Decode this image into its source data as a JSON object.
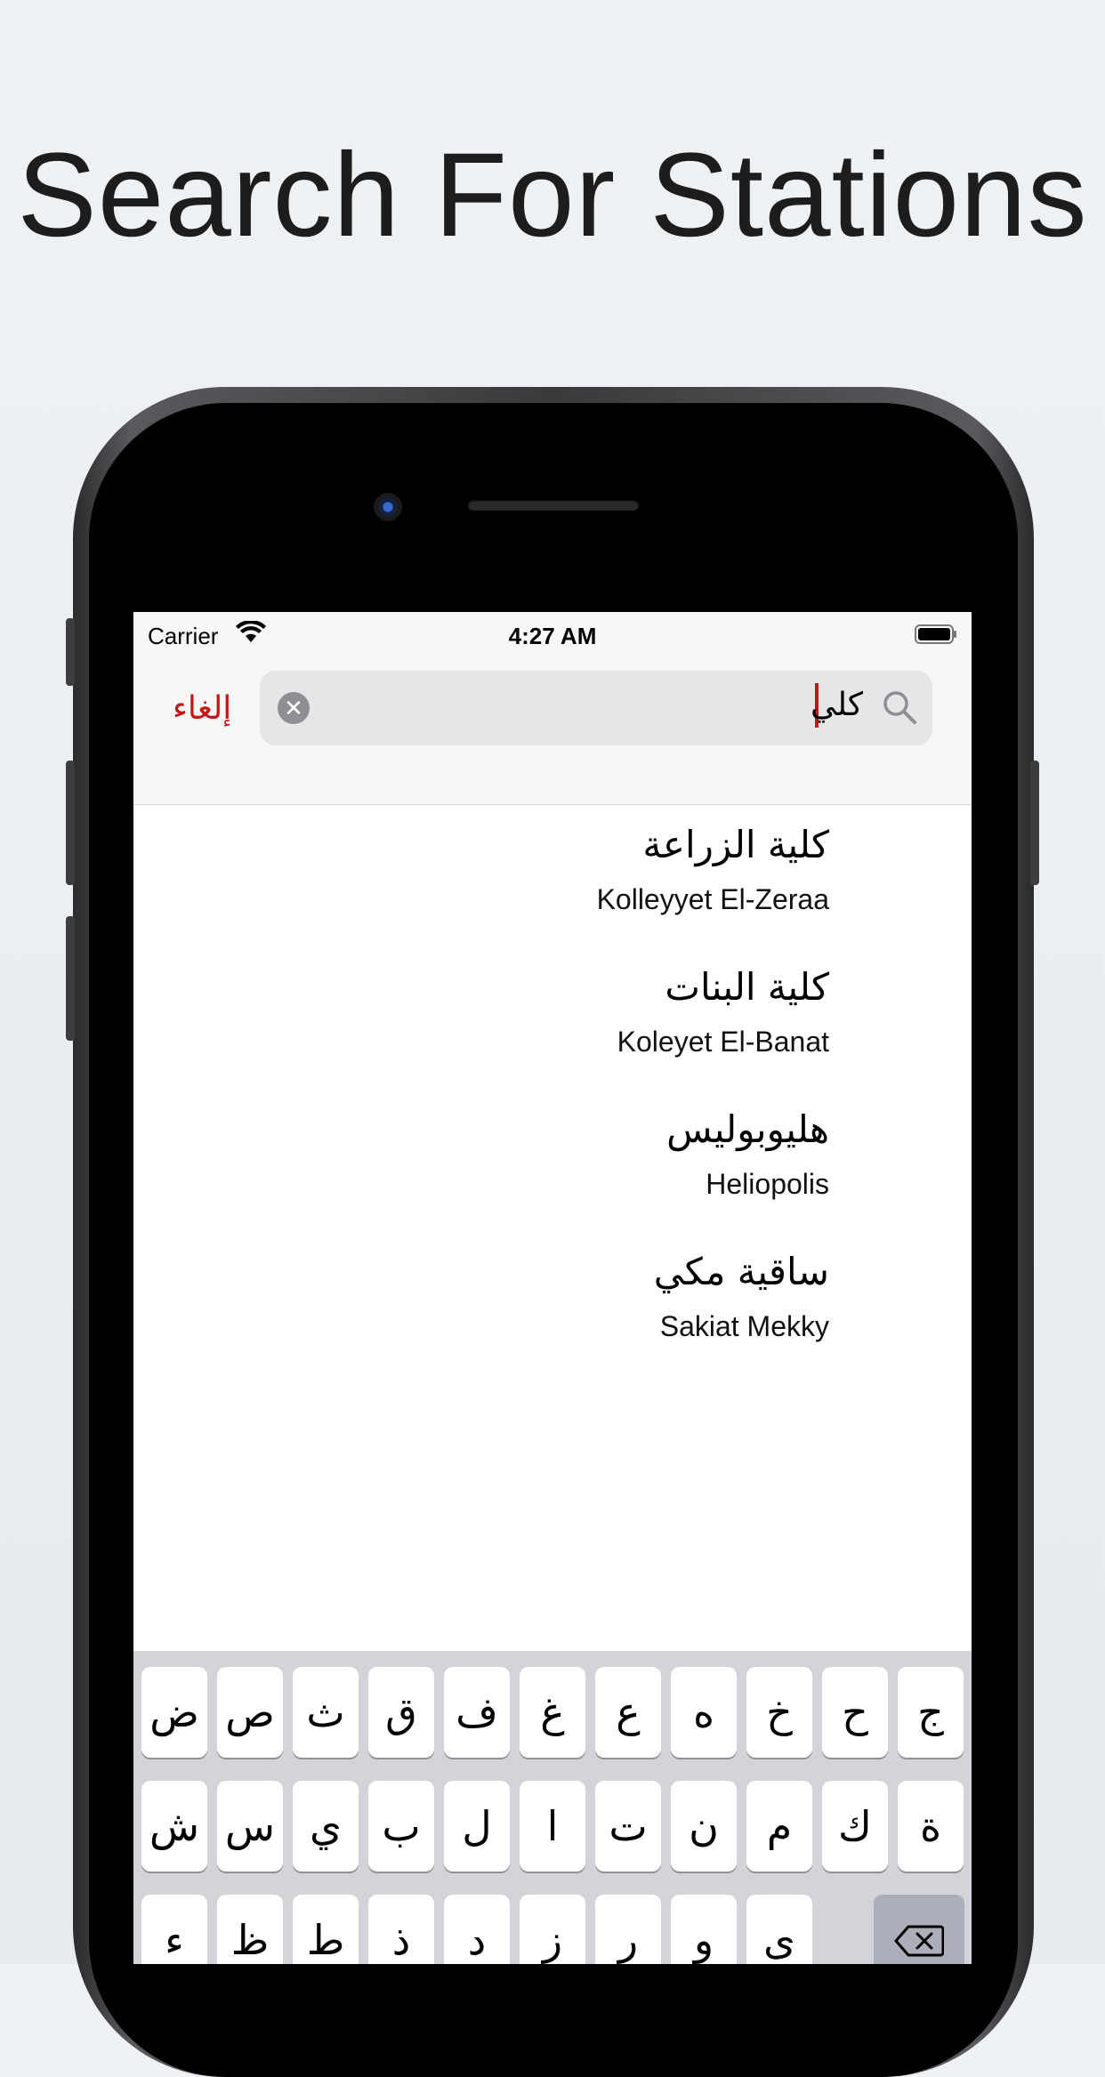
{
  "headline": "Search For Stations",
  "status_bar": {
    "carrier": "Carrier",
    "time": "4:27 AM"
  },
  "search": {
    "cancel_label": "إلغاء",
    "query": "كلي",
    "clear_icon": "clear-circle-icon",
    "search_icon": "magnifier-icon"
  },
  "results": [
    {
      "arabic": "كلية الزراعة",
      "english": "Kolleyyet El-Zeraa"
    },
    {
      "arabic": "كلية البنات",
      "english": "Koleyet El-Banat"
    },
    {
      "arabic": "هليوبوليس",
      "english": "Heliopolis"
    },
    {
      "arabic": "ساقية مكي",
      "english": "Sakiat Mekky"
    }
  ],
  "keyboard": {
    "row1": [
      "ض",
      "ص",
      "ث",
      "ق",
      "ف",
      "غ",
      "ع",
      "ه",
      "خ",
      "ح",
      "ج"
    ],
    "row2": [
      "ش",
      "س",
      "ي",
      "ب",
      "ل",
      "ا",
      "ت",
      "ن",
      "م",
      "ك",
      "ة"
    ],
    "row3": [
      "ء",
      "ظ",
      "ط",
      "ذ",
      "د",
      "ز",
      "ر",
      "و",
      "ى"
    ],
    "delete_icon": "backspace-icon"
  },
  "colors": {
    "accent": "#c2161b",
    "background": "#eef1f3",
    "keyboard_bg": "#d2d4d9"
  }
}
